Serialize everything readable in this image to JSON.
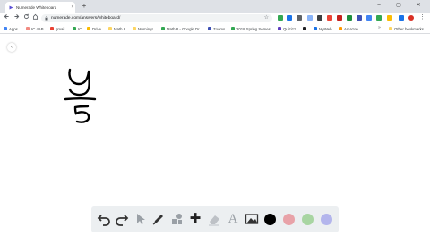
{
  "browser": {
    "tab_title": "Numerade Whiteboard",
    "new_tab_glyph": "+",
    "close_glyph": "×",
    "window_controls": [
      "–",
      "▢",
      "✕"
    ],
    "url": "numerade.com/answers/whiteboard/"
  },
  "bookmarks": {
    "items": [
      {
        "label": "Apps",
        "color": "#4285f4"
      },
      {
        "label": "IC 4AB",
        "color": "#f28b82"
      },
      {
        "label": "gmail",
        "color": "#ea4335"
      },
      {
        "label": "IC",
        "color": "#34a853"
      },
      {
        "label": "Drive",
        "color": "#fbbc04"
      },
      {
        "label": "Math 8",
        "color": "#fdd663"
      },
      {
        "label": "Morning!",
        "color": "#fdd663"
      },
      {
        "label": "Math 8 - Google Dr...",
        "color": "#34a853"
      },
      {
        "label": "Zooms",
        "color": "#3f51b5"
      },
      {
        "label": "2018 Spring Semes...",
        "color": "#34a853"
      },
      {
        "label": "Quizizz",
        "color": "#5f3fbf"
      },
      {
        "label": "",
        "color": "#202124"
      },
      {
        "label": "MyWeb",
        "color": "#1a73e8"
      },
      {
        "label": "Amazon",
        "color": "#ff9900"
      }
    ],
    "more_glyph": "»",
    "other_label": "Other bookmarks"
  },
  "whiteboard": {
    "collapse_glyph": "‹",
    "handwriting": "y/5"
  },
  "toolbar": {
    "tools": [
      "undo-icon",
      "redo-icon",
      "pointer-icon",
      "pen-icon",
      "shapes-icon",
      "plus-icon",
      "eraser-icon",
      "text-icon",
      "image-icon"
    ],
    "text_tool_glyph": "A",
    "plus_glyph": "✚",
    "colors": [
      "#000000",
      "#e8a2a8",
      "#a8d5a2",
      "#b3b5ec"
    ]
  }
}
